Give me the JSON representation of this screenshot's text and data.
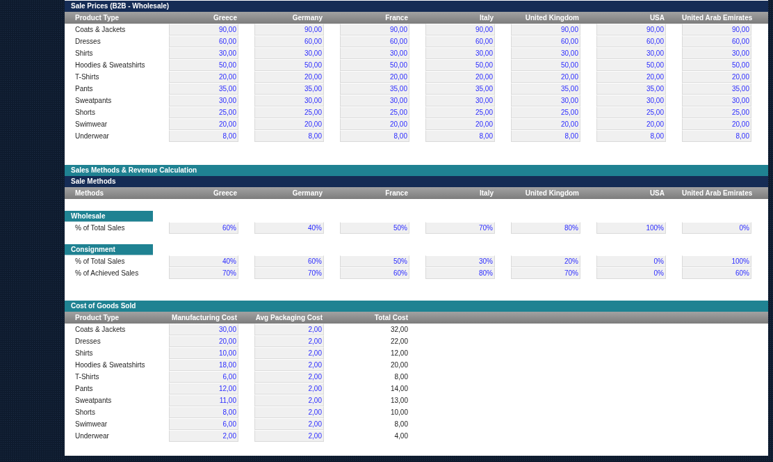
{
  "sections": [
    {
      "kind": "table",
      "title": "Sale Prices (B2B - Wholesale)",
      "columns": [
        {
          "label": "Product Type",
          "kind": "label"
        },
        {
          "label": "Greece",
          "kind": "input"
        },
        {
          "label": "Germany",
          "kind": "input"
        },
        {
          "label": "France",
          "kind": "input"
        },
        {
          "label": "Italy",
          "kind": "input"
        },
        {
          "label": "United Kingdom",
          "kind": "input"
        },
        {
          "label": "USA",
          "kind": "input"
        },
        {
          "label": "United Arab Emirates",
          "kind": "input"
        }
      ],
      "rows": [
        {
          "label": "Coats & Jackets",
          "values": [
            "90,00",
            "90,00",
            "90,00",
            "90,00",
            "90,00",
            "90,00",
            "90,00"
          ]
        },
        {
          "label": "Dresses",
          "values": [
            "60,00",
            "60,00",
            "60,00",
            "60,00",
            "60,00",
            "60,00",
            "60,00"
          ]
        },
        {
          "label": "Shirts",
          "values": [
            "30,00",
            "30,00",
            "30,00",
            "30,00",
            "30,00",
            "30,00",
            "30,00"
          ]
        },
        {
          "label": "Hoodies & Sweatshirts",
          "values": [
            "50,00",
            "50,00",
            "50,00",
            "50,00",
            "50,00",
            "50,00",
            "50,00"
          ]
        },
        {
          "label": "T-Shirts",
          "values": [
            "20,00",
            "20,00",
            "20,00",
            "20,00",
            "20,00",
            "20,00",
            "20,00"
          ]
        },
        {
          "label": "Pants",
          "values": [
            "35,00",
            "35,00",
            "35,00",
            "35,00",
            "35,00",
            "35,00",
            "35,00"
          ]
        },
        {
          "label": "Sweatpants",
          "values": [
            "30,00",
            "30,00",
            "30,00",
            "30,00",
            "30,00",
            "30,00",
            "30,00"
          ]
        },
        {
          "label": "Shorts",
          "values": [
            "25,00",
            "25,00",
            "25,00",
            "25,00",
            "25,00",
            "25,00",
            "25,00"
          ]
        },
        {
          "label": "Swimwear",
          "values": [
            "20,00",
            "20,00",
            "20,00",
            "20,00",
            "20,00",
            "20,00",
            "20,00"
          ]
        },
        {
          "label": "Underwear",
          "values": [
            "8,00",
            "8,00",
            "8,00",
            "8,00",
            "8,00",
            "8,00",
            "8,00"
          ]
        }
      ]
    },
    {
      "kind": "banner",
      "title": "Sales Methods & Revenue Calculation"
    },
    {
      "kind": "groups",
      "title": "Sale Methods",
      "columns": [
        {
          "label": "Methods",
          "kind": "label"
        },
        {
          "label": "Greece",
          "kind": "input"
        },
        {
          "label": "Germany",
          "kind": "input"
        },
        {
          "label": "France",
          "kind": "input"
        },
        {
          "label": "Italy",
          "kind": "input"
        },
        {
          "label": "United Kingdom",
          "kind": "input"
        },
        {
          "label": "USA",
          "kind": "input"
        },
        {
          "label": "United Arab Emirates",
          "kind": "input"
        }
      ],
      "groups": [
        {
          "title": "Wholesale",
          "rows": [
            {
              "label": "% of Total Sales",
              "values": [
                "60%",
                "40%",
                "50%",
                "70%",
                "80%",
                "100%",
                "0%"
              ]
            }
          ]
        },
        {
          "title": "Consignment",
          "rows": [
            {
              "label": "% of Total Sales",
              "values": [
                "40%",
                "60%",
                "50%",
                "30%",
                "20%",
                "0%",
                "100%"
              ]
            },
            {
              "label": "% of Achieved Sales",
              "values": [
                "70%",
                "70%",
                "60%",
                "80%",
                "70%",
                "0%",
                "60%"
              ]
            }
          ]
        }
      ]
    },
    {
      "kind": "table",
      "title": "Cost of Goods Sold",
      "columns": [
        {
          "label": "Product Type",
          "kind": "label"
        },
        {
          "label": "Manufacturing Cost",
          "kind": "input"
        },
        {
          "label": "Avg Packaging Cost",
          "kind": "input"
        },
        {
          "label": "Total Cost",
          "kind": "calc"
        }
      ],
      "rows": [
        {
          "label": "Coats & Jackets",
          "values": [
            "30,00",
            "2,00",
            "32,00"
          ]
        },
        {
          "label": "Dresses",
          "values": [
            "20,00",
            "2,00",
            "22,00"
          ]
        },
        {
          "label": "Shirts",
          "values": [
            "10,00",
            "2,00",
            "12,00"
          ]
        },
        {
          "label": "Hoodies & Sweatshirts",
          "values": [
            "18,00",
            "2,00",
            "20,00"
          ]
        },
        {
          "label": "T-Shirts",
          "values": [
            "6,00",
            "2,00",
            "8,00"
          ]
        },
        {
          "label": "Pants",
          "values": [
            "12,00",
            "2,00",
            "14,00"
          ]
        },
        {
          "label": "Sweatpants",
          "values": [
            "11,00",
            "2,00",
            "13,00"
          ]
        },
        {
          "label": "Shorts",
          "values": [
            "8,00",
            "2,00",
            "10,00"
          ]
        },
        {
          "label": "Swimwear",
          "values": [
            "6,00",
            "2,00",
            "8,00"
          ]
        },
        {
          "label": "Underwear",
          "values": [
            "2,00",
            "2,00",
            "4,00"
          ]
        }
      ]
    }
  ]
}
